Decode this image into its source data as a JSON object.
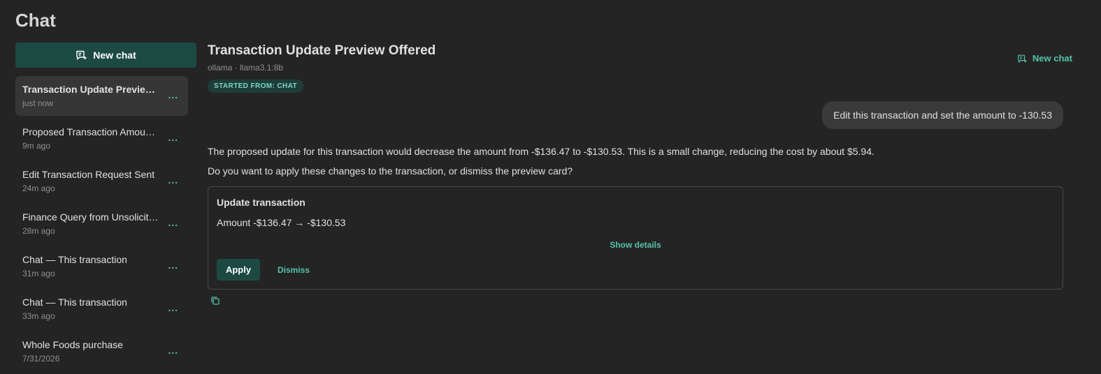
{
  "page": {
    "title": "Chat"
  },
  "sidebar": {
    "new_chat_label": "New chat",
    "items": [
      {
        "title": "Transaction Update Preview Offered",
        "time": "just now",
        "active": true
      },
      {
        "title": "Proposed Transaction Amount Update",
        "time": "9m ago"
      },
      {
        "title": "Edit Transaction Request Sent",
        "time": "24m ago"
      },
      {
        "title": "Finance Query from Unsolicited",
        "time": "28m ago"
      },
      {
        "title": "Chat — This transaction",
        "time": "31m ago"
      },
      {
        "title": "Chat — This transaction",
        "time": "33m ago"
      },
      {
        "title": "Whole Foods purchase",
        "time": "7/31/2026"
      }
    ],
    "item_menu_label": "..."
  },
  "conversation": {
    "title": "Transaction Update Preview Offered",
    "model": "ollama · llama3.1:8b",
    "badge": "STARTED FROM: CHAT",
    "new_chat_label": "New chat",
    "user_message": "Edit this transaction and set the amount to -130.53",
    "assistant_lines": [
      "The proposed update for this transaction would decrease the amount from -$136.47 to -$130.53. This is a small change, reducing the cost by about $5.94.",
      "Do you want to apply these changes to the transaction, or dismiss the preview card?"
    ]
  },
  "card": {
    "title": "Update transaction",
    "amount_line": "Amount -$136.47 → -$130.53",
    "show_details": "Show details",
    "apply_label": "Apply",
    "dismiss_label": "Dismiss"
  },
  "icons": {
    "new_chat": "chat-plus-icon",
    "copy": "copy-icon"
  },
  "colors": {
    "accent": "#55c2a8",
    "button_bg": "#1c4a43",
    "background": "#242424"
  }
}
